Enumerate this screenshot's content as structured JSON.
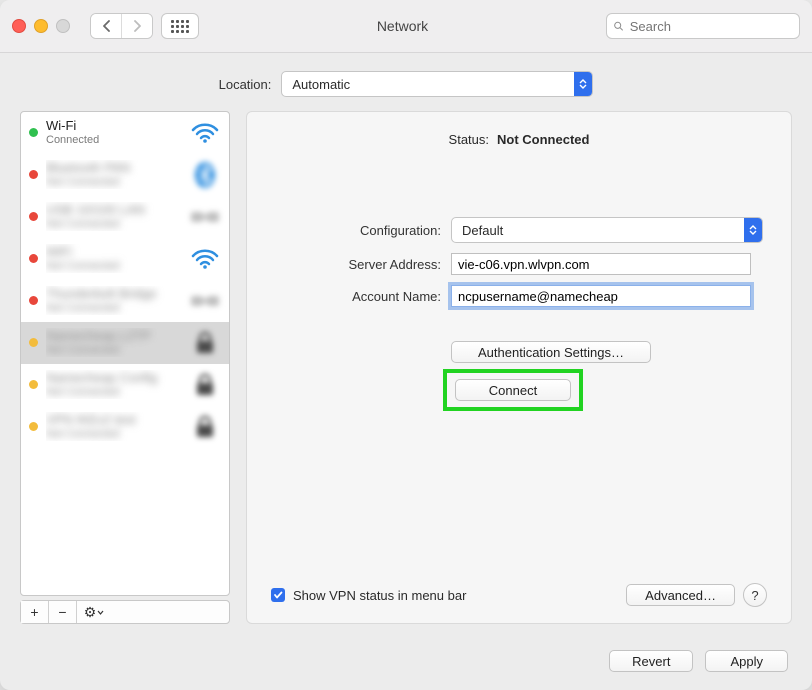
{
  "window_title": "Network",
  "search_placeholder": "Search",
  "location": {
    "label": "Location:",
    "selected": "Automatic"
  },
  "sidebar": {
    "items": [
      {
        "name": "Wi-Fi",
        "sub": "Connected",
        "status": "green",
        "icon": "wifi",
        "blur": false
      },
      {
        "name": "Bluetooth PAN",
        "sub": "Not Connected",
        "status": "red",
        "icon": "bluetooth",
        "blur": true
      },
      {
        "name": "USB 10/100 LAN",
        "sub": "Not Connected",
        "status": "red",
        "icon": "dongle",
        "blur": true
      },
      {
        "name": "WiFi",
        "sub": "Not Connected",
        "status": "red",
        "icon": "wifi",
        "blur": true
      },
      {
        "name": "Thunderbolt Bridge",
        "sub": "Not Connected",
        "status": "red",
        "icon": "dongle",
        "blur": true
      },
      {
        "name": "Namecheap L2TP",
        "sub": "Not Connected",
        "status": "yellow",
        "icon": "vpn",
        "blur": true,
        "selected": true
      },
      {
        "name": "Namecheap Config",
        "sub": "Not Connected",
        "status": "yellow",
        "icon": "lock",
        "blur": true
      },
      {
        "name": "VPN IKEv2 test",
        "sub": "Not Connected",
        "status": "yellow",
        "icon": "vpn",
        "blur": true
      }
    ],
    "buttons": {
      "add": "+",
      "remove": "−",
      "action": "⚙︎"
    }
  },
  "detail": {
    "status_label": "Status:",
    "status_value": "Not Connected",
    "configuration_label": "Configuration:",
    "configuration_value": "Default",
    "server_label": "Server Address:",
    "server_value": "vie-c06.vpn.wlvpn.com",
    "account_label": "Account Name:",
    "account_value": "ncpusername@namecheap",
    "auth_settings": "Authentication Settings…",
    "connect": "Connect",
    "show_vpn_checkbox": "Show VPN status in menu bar",
    "show_vpn_checked": true,
    "advanced": "Advanced…",
    "help": "?"
  },
  "footer": {
    "revert": "Revert",
    "apply": "Apply"
  }
}
